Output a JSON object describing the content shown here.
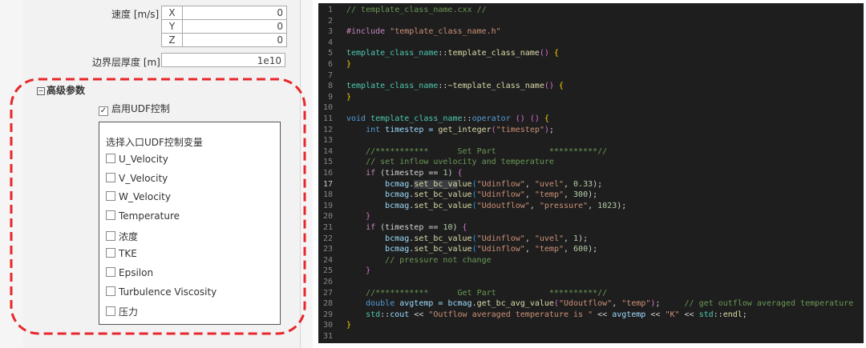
{
  "left_panel": {
    "speed_label": "速度 [m/s]",
    "speed": [
      {
        "axis": "X",
        "value": "0"
      },
      {
        "axis": "Y",
        "value": "0"
      },
      {
        "axis": "Z",
        "value": "0"
      }
    ],
    "boundary_label": "边界层厚度 [m]",
    "boundary_value": "1e10",
    "section_title": "高级参数",
    "section_toggle": "⊟",
    "udf_enable_label": "启用UDF控制",
    "udf_enable_checked": true,
    "udf_var_title": "选择入口UDF控制变量",
    "udf_vars": [
      "U_Velocity",
      "V_Velocity",
      "W_Velocity",
      "Temperature",
      "浓度",
      "TKE",
      "Epsilon",
      "Turbulence Viscosity",
      "压力"
    ],
    "highlight_color": "#e8262b"
  },
  "editor": {
    "line_numbers": [
      "1",
      "2",
      "3",
      "4",
      "5",
      "6",
      "7",
      "8",
      "9",
      "10",
      "11",
      "12",
      "13",
      "14",
      "15",
      "16",
      "17",
      "18",
      "19",
      "20",
      "21",
      "22",
      "23",
      "24",
      "25",
      "26",
      "27",
      "28",
      "29",
      "30",
      "31"
    ],
    "current_line": "17",
    "colors": {
      "background": "#1e1e1e",
      "comment": "#6a9955",
      "keyword": "#569cd6",
      "string": "#ce9178",
      "type": "#4ec9b0",
      "function": "#dcdcaa",
      "number": "#b5cea8"
    },
    "t": {
      "c1": "// template_class_name.cxx //",
      "inc": "#include",
      "incfile": "\"template_class_name.h\"",
      "cls": "template_class_name",
      "sep": "::",
      "ctor": "template_class_name",
      "parens": "() ",
      "ob": "{",
      "cb": "}",
      "dtor": "~template_class_name",
      "void": "void",
      "operator": "operator",
      "op_parens": " () ",
      "int": "int",
      "timestep_decl": " timestep = ",
      "get_integer": "get_integer",
      "lp": "(",
      "rp": ")",
      "str_timestep": "\"timestep\"",
      "semi": ";",
      "c_set": "//***********      Set Part           **********//",
      "c_inflow": "// set inflow uvelocity and temperature",
      "if": "if",
      "cond1": " (timestep == ",
      "n1": "1",
      "n10": "10",
      "cond_end": ") ",
      "bcmag": "bcmag",
      "dot": ".",
      "set_bc_value": "set_bc_value",
      "set_hl": "set_bc_va",
      "set_rest": "lue",
      "udinflow": "\"Udinflow\"",
      "udoutflow": "\"Udoutflow\"",
      "uvel": "\"uvel\"",
      "temp": "\"temp\"",
      "pressure": "\"pressure\"",
      "comma": ", ",
      "v033": "0.33",
      "v300": "300",
      "v1023": "1023",
      "v1": "1",
      "v600": "600",
      "endcall": ");",
      "c_pressure": "// pressure not change",
      "c_get": "//***********      Get Part           **********//",
      "double": "double",
      "avgtemp_decl": " avgtemp = ",
      "get_bc_avg_value": "get_bc_avg_value",
      "c_avg": "// get outflow averaged temperature",
      "std": "std",
      "cout": "cout",
      "shl": " << ",
      "str_outflow": "\"Outflow averaged temperature is \"",
      "avgtemp": "avgtemp",
      "str_k": "\"K\"",
      "endl": "endl"
    }
  }
}
